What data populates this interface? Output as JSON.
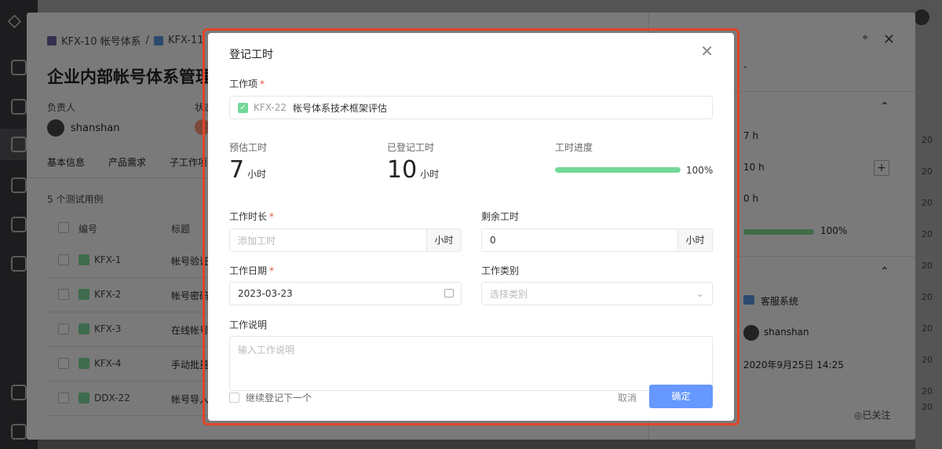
{
  "background": {
    "breadcrumb": {
      "parent": "KFX-10 帐号体系",
      "current": "KFX-11",
      "separator": "/"
    },
    "title": "企业内部帐号体系管理",
    "owner_label": "负责人",
    "owner_name": "shanshan",
    "status_label": "状态",
    "tabs": [
      "基本信息",
      "产品需求",
      "子工作项"
    ],
    "test_count": "5 个测试用例",
    "table_headers": [
      "编号",
      "标题"
    ],
    "rows": [
      {
        "code": "KFX-1",
        "title": "帐号验证"
      },
      {
        "code": "KFX-2",
        "title": "帐号密码"
      },
      {
        "code": "KFX-3",
        "title": "在线帐号"
      },
      {
        "code": "KFX-4",
        "title": "手动批量"
      },
      {
        "code": "DDX-22",
        "title": "帐号导入"
      }
    ],
    "side": {
      "dash": "-",
      "est": "7 h",
      "logged": "10 h",
      "remain": "0 h",
      "progress_pct": "100%",
      "project": "客服系统",
      "creator": "shanshan",
      "created_at": "2020年9月25日 14:25",
      "follow": "◎已关注"
    },
    "right_years": [
      "20",
      "20",
      "20",
      "20",
      "20",
      "20",
      "20",
      "20",
      "20",
      "20"
    ]
  },
  "modal": {
    "title": "登记工时",
    "work_item_label": "工作项",
    "work_item": {
      "code": "KFX-22",
      "title": "帐号体系技术框架评估"
    },
    "estimated_label": "预估工时",
    "estimated_value": "7",
    "estimated_unit": "小时",
    "logged_label": "已登记工时",
    "logged_value": "10",
    "logged_unit": "小时",
    "progress_label": "工时进度",
    "progress_fraction": 1.0,
    "progress_text": "100%",
    "duration_label": "工作时长",
    "duration_placeholder": "添加工时",
    "duration_unit": "小时",
    "remain_label": "剩余工时",
    "remain_value": "0",
    "remain_unit": "小时",
    "date_label": "工作日期",
    "date_value": "2023-03-23",
    "category_label": "工作类别",
    "category_placeholder": "选择类别",
    "desc_label": "工作说明",
    "desc_placeholder": "输入工作说明",
    "continue_label": "继续登记下一个",
    "cancel_label": "取消",
    "ok_label": "确定"
  },
  "colors": {
    "primary": "#6698ff",
    "progress": "#73d897",
    "required": "#e8553e",
    "highlight_frame": "#e2442a"
  }
}
